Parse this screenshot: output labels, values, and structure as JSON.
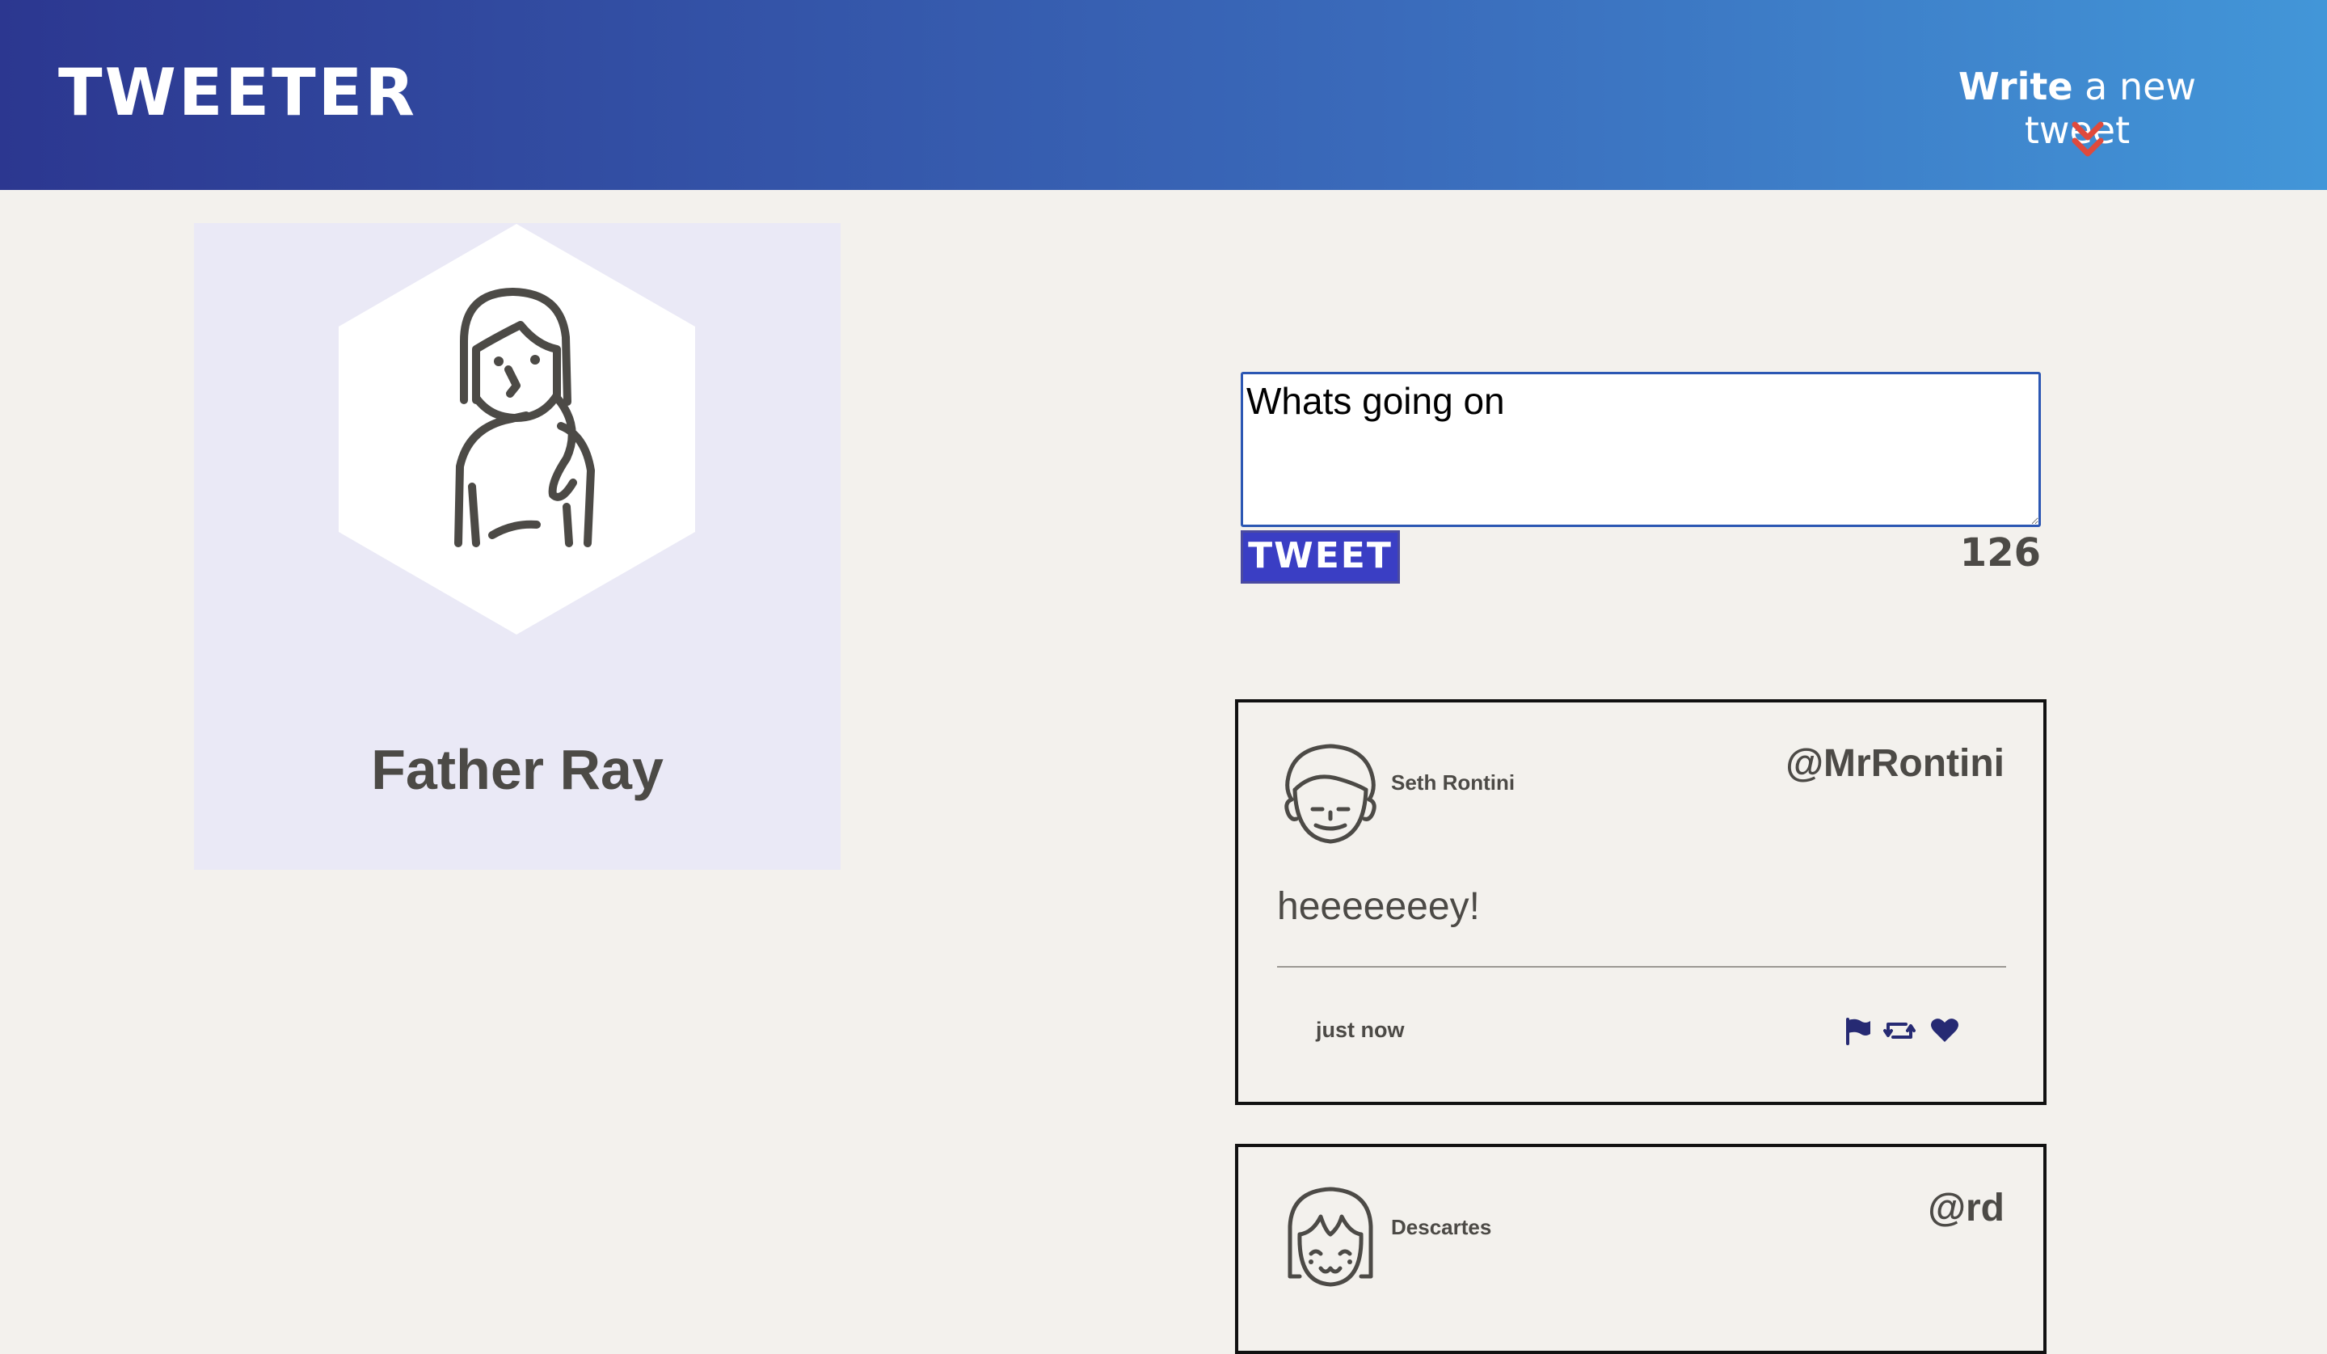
{
  "navbar": {
    "brand": "TWEETER",
    "compose_toggle_bold": "Write",
    "compose_toggle_rest": " a new tweet",
    "toggle_icon": "double-chevron-down-icon",
    "toggle_icon_color": "#e04a3c"
  },
  "profile": {
    "avatar_icon": "woman-avatar-icon",
    "name": "Father Ray"
  },
  "compose": {
    "text": "Whats going on",
    "button_label": "TWEET",
    "char_counter": "126"
  },
  "tweets": [
    {
      "avatar_icon": "man-avatar-icon",
      "author": "Seth Rontini",
      "handle": "@MrRontini",
      "content": "heeeeeeey!",
      "time": "just now",
      "actions": [
        "flag-icon",
        "retweet-icon",
        "heart-icon"
      ]
    },
    {
      "avatar_icon": "girl-avatar-icon",
      "author": "Descartes",
      "handle": "@rd"
    }
  ],
  "colors": {
    "nav_gradient_start": "#2c3790",
    "nav_gradient_end": "#4296d8",
    "page_background": "#f3f1ed",
    "profile_card_background": "#eae9f6",
    "tweet_button": "#3a3ec4",
    "text_dark": "#4c4a46",
    "action_icons": "#262a73"
  }
}
